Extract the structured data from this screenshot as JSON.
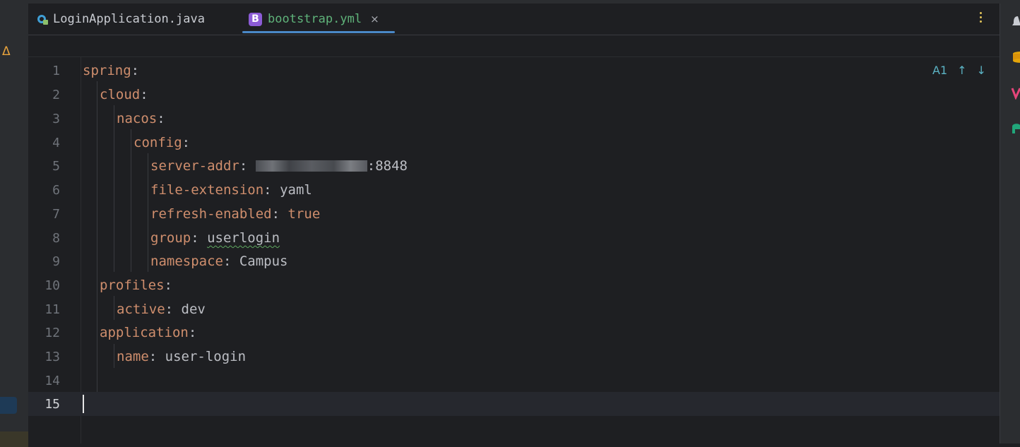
{
  "tabs": [
    {
      "label": "LoginApplication.java",
      "icon": "java-class-icon",
      "active": false
    },
    {
      "label": "bootstrap.yml",
      "icon": "yaml-bootstrap-icon",
      "icon_letter": "B",
      "active": true
    }
  ],
  "close_glyph": "×",
  "left_gutter": {
    "warning_glyph": "Δ"
  },
  "inspection": {
    "icon": "spell-check-icon",
    "glyph": "A",
    "count": "1",
    "prev_arrow": "↑",
    "next_arrow": "↓"
  },
  "code_lines": [
    {
      "num": "1",
      "key": "spring",
      "colon": ":",
      "value": ""
    },
    {
      "num": "2",
      "key": "cloud",
      "colon": ":",
      "value": ""
    },
    {
      "num": "3",
      "key": "nacos",
      "colon": ":",
      "value": ""
    },
    {
      "num": "4",
      "key": "config",
      "colon": ":",
      "value": ""
    },
    {
      "num": "5",
      "key": "server-addr",
      "colon": ":",
      "value": ":8848",
      "redacted": true
    },
    {
      "num": "6",
      "key": "file-extension",
      "colon": ":",
      "value": "yaml"
    },
    {
      "num": "7",
      "key": "refresh-enabled",
      "colon": ":",
      "value": "true"
    },
    {
      "num": "8",
      "key": "group",
      "colon": ":",
      "value": "userlogin"
    },
    {
      "num": "9",
      "key": "namespace",
      "colon": ":",
      "value": "Campus"
    },
    {
      "num": "10",
      "key": "profiles",
      "colon": ":",
      "value": ""
    },
    {
      "num": "11",
      "key": "active",
      "colon": ":",
      "value": "dev"
    },
    {
      "num": "12",
      "key": "application",
      "colon": ":",
      "value": ""
    },
    {
      "num": "13",
      "key": "name",
      "colon": ":",
      "value": "user-login"
    },
    {
      "num": "14",
      "key": "",
      "colon": "",
      "value": ""
    },
    {
      "num": "15",
      "key": "",
      "colon": "",
      "value": ""
    }
  ],
  "right_toolbar": [
    "notifications-icon",
    "database-icon",
    "plugin-v-icon",
    "ai-assistant-icon"
  ],
  "colors": {
    "key": "#cf8e6d",
    "text": "#bcbec4",
    "active_tab": "#5fb37a",
    "accent": "#4a88c7",
    "yml_badge": "#8c5cd6"
  }
}
